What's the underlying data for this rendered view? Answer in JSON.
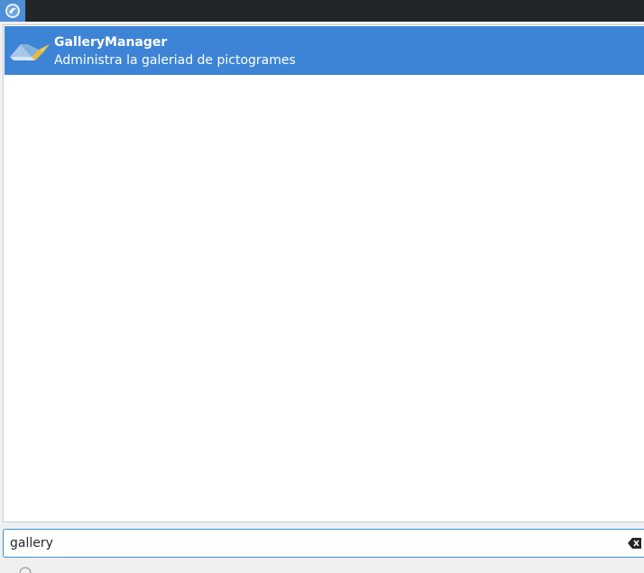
{
  "launcher": {
    "icon": "launcher-icon",
    "accent": "#4d8fd6"
  },
  "results": {
    "items": [
      {
        "title": "GalleryManager",
        "description": "Administra la galeriad de pictogrames",
        "icon": "gallery-manager-icon",
        "selected": true,
        "highlight_color": "#3d84d6"
      }
    ]
  },
  "search": {
    "value": "gallery",
    "clear_icon": "backspace-clear-icon"
  }
}
